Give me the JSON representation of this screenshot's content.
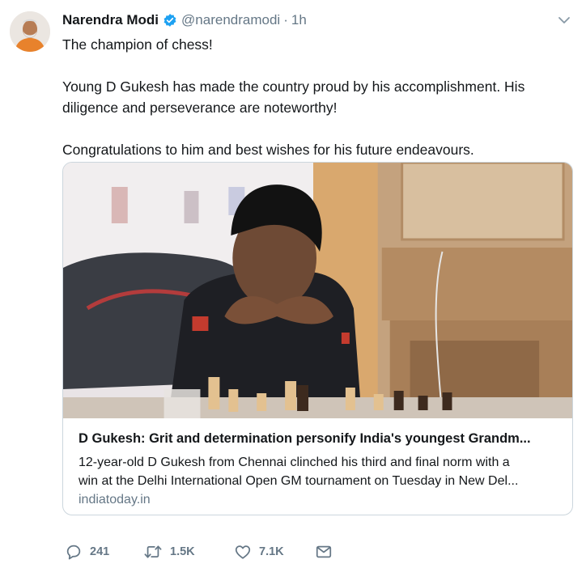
{
  "author": {
    "name": "Narendra Modi",
    "handle": "@narendramodi",
    "separator": "·",
    "time": "1h",
    "verified": true
  },
  "tweet": {
    "paragraphs": [
      "The champion of chess!",
      "Young D Gukesh has made the country proud by his accomplishment. His diligence and perseverance are noteworthy!",
      "Congratulations to him and best wishes for his future endeavours."
    ]
  },
  "card": {
    "title": "D Gukesh: Grit and determination personify India's youngest Grandm...",
    "description_lines": [
      "12-year-old D Gukesh from Chennai clinched his third and final norm with a",
      "win at the Delhi International Open GM tournament on Tuesday in New Del..."
    ],
    "domain": "indiatoday.in"
  },
  "actions": {
    "replies": "241",
    "retweets": "1.5K",
    "likes": "7.1K"
  },
  "colors": {
    "text": "#14171a",
    "secondary": "#657786",
    "verified": "#1da1f2",
    "border": "#ccd6dd"
  },
  "icons": [
    "verified-badge-icon",
    "chevron-down-icon",
    "reply-icon",
    "retweet-icon",
    "heart-icon",
    "envelope-icon"
  ]
}
